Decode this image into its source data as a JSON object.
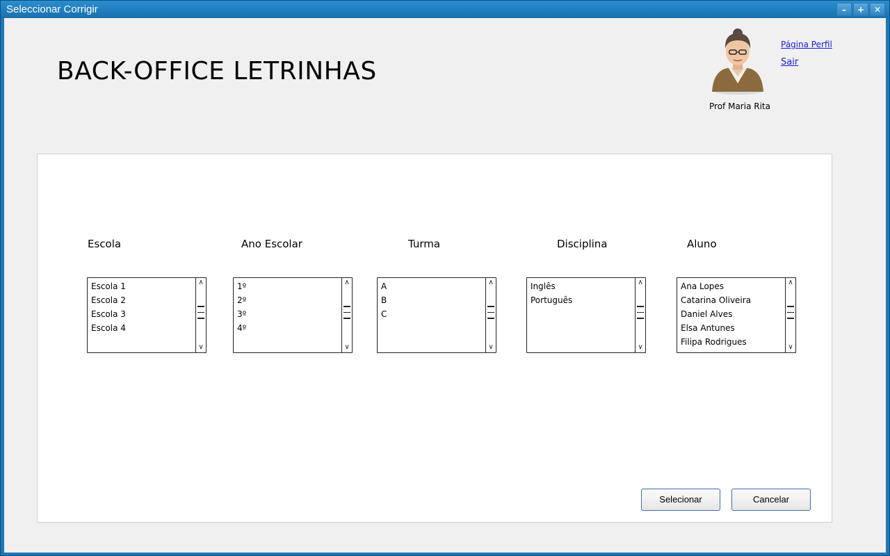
{
  "window": {
    "title": "Seleccionar Corrigir",
    "controls": {
      "minimize": "–",
      "maximize": "+",
      "close": "✕"
    }
  },
  "header": {
    "app_title": "BACK-OFFICE LETRINHAS",
    "user_name": "Prof Maria Rita",
    "profile_link": "Página Perfil",
    "logout_link": "Sair",
    "avatar_icon": "user-avatar-icon"
  },
  "selectors": {
    "escola": {
      "label": "Escola",
      "items": [
        "Escola 1",
        "Escola 2",
        "Escola 3",
        "Escola 4",
        ""
      ]
    },
    "ano": {
      "label": "Ano Escolar",
      "items": [
        "1º",
        "2º",
        "3º",
        "4º",
        ""
      ]
    },
    "turma": {
      "label": "Turma",
      "items": [
        "A",
        "B",
        "C",
        "",
        ""
      ]
    },
    "disciplina": {
      "label": "Disciplina",
      "items": [
        "Inglês",
        "Português",
        "",
        "",
        ""
      ]
    },
    "aluno": {
      "label": "Aluno",
      "items": [
        "Ana Lopes",
        "Catarina Oliveira",
        "Daniel Alves",
        "Elsa Antunes",
        "Filipa Rodrigues"
      ]
    }
  },
  "actions": {
    "select_label": "Selecionar",
    "cancel_label": "Cancelar"
  },
  "colors": {
    "window_frame": "#1f77b4",
    "link": "#1a1ae6",
    "button_border": "#3d6fa8"
  }
}
